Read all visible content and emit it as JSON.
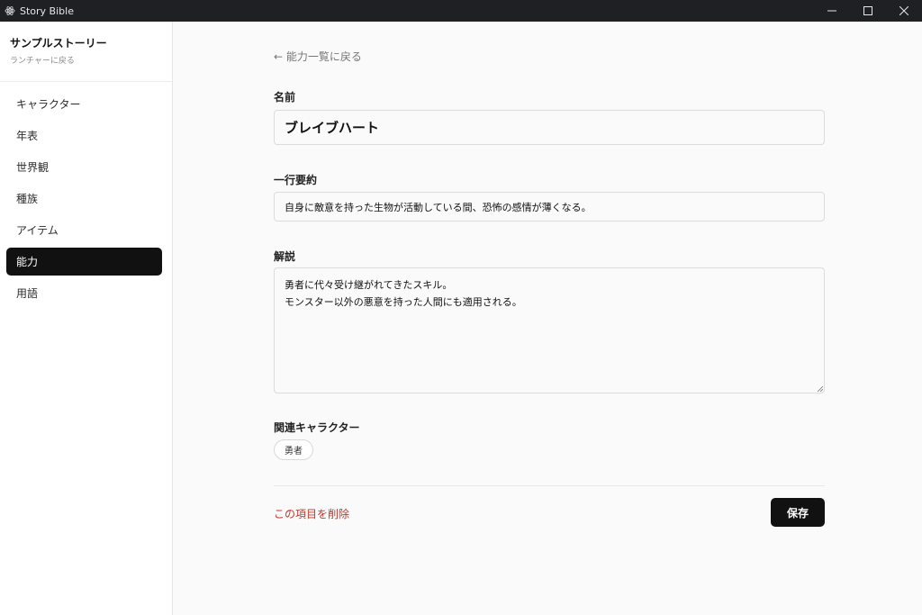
{
  "window": {
    "title": "Story Bible",
    "app_icon": "atom-icon",
    "controls": [
      "minimize-icon",
      "maximize-icon",
      "close-icon"
    ]
  },
  "sidebar": {
    "project_name": "サンプルストーリー",
    "launcher_link": "ランチャーに戻る",
    "items": [
      {
        "label": "キャラクター",
        "active": false
      },
      {
        "label": "年表",
        "active": false
      },
      {
        "label": "世界観",
        "active": false
      },
      {
        "label": "種族",
        "active": false
      },
      {
        "label": "アイテム",
        "active": false
      },
      {
        "label": "能力",
        "active": true
      },
      {
        "label": "用語",
        "active": false
      }
    ]
  },
  "main": {
    "back_link": "← 能力一覧に戻る",
    "name_label": "名前",
    "name_value": "ブレイブハート",
    "summary_label": "一行要約",
    "summary_value": "自身に敵意を持った生物が活動している間、恐怖の感情が薄くなる。",
    "description_label": "解説",
    "description_lines": [
      "勇者に代々受け継がれてきたスキル。",
      "モンスター以外の悪意を持った人間にも適用される。"
    ],
    "related_label": "関連キャラクター",
    "related_characters": [
      "勇者"
    ],
    "delete_label": "この項目を削除",
    "save_label": "保存"
  },
  "colors": {
    "titlebar": "#1e2024",
    "accent": "#111111",
    "danger": "#c0392b"
  }
}
